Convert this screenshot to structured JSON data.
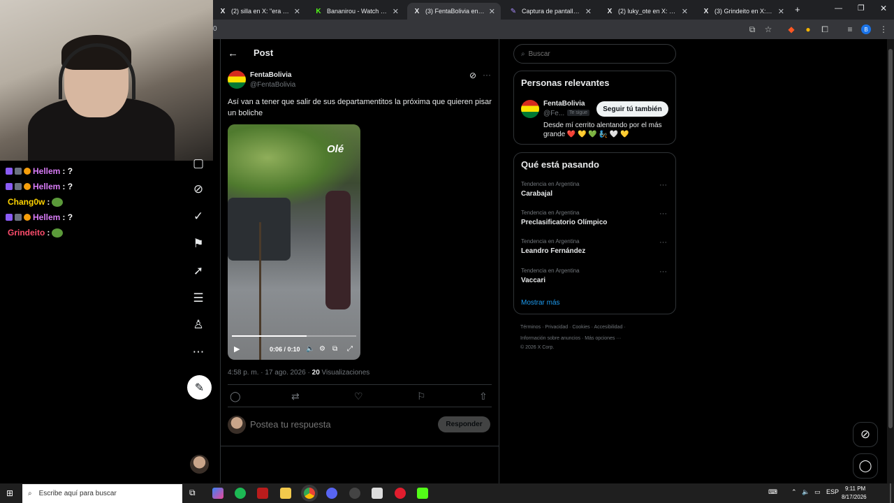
{
  "browser": {
    "tabs": [
      {
        "icon": "X",
        "title": "(2) silla en X: \"era el gol d",
        "active": false
      },
      {
        "icon": "K",
        "title": "Bananirou - Watch clips o",
        "active": false
      },
      {
        "icon": "X",
        "title": "(3) FentaBolivia en X: \"Así",
        "active": true
      },
      {
        "icon": "✎",
        "title": "Captura de pantalla por L",
        "active": false
      },
      {
        "icon": "X",
        "title": "(2) luky_ote en X: \"Hola E",
        "active": false
      },
      {
        "icon": "X",
        "title": "(3) Grindeito en X: \"@Fer",
        "active": false
      }
    ],
    "new_tab": "+",
    "address_fragment": "0"
  },
  "chat": [
    {
      "user": "Hellem",
      "msg": ": ?",
      "color": "#d97cf7",
      "badges": true
    },
    {
      "user": "Hellem",
      "msg": ": ?",
      "color": "#d97cf7",
      "badges": true
    },
    {
      "user": "Chang0w",
      "msg": ":",
      "color": "#ffd400",
      "emote": "pepe",
      "badges": false
    },
    {
      "user": "Hellem",
      "msg": ": ?",
      "color": "#d97cf7",
      "badges": true
    },
    {
      "user": "Grindeito",
      "msg": ":",
      "color": "#ff4d6d",
      "emote": "pepe",
      "badges": false
    }
  ],
  "post": {
    "header_title": "Post",
    "author_name": "FentaBolivia",
    "author_handle": "@FentaBolivia",
    "text": "Así van a tener que salir de sus departamentitos la próxima que quieren pisar un boliche",
    "video_watermark": "Olé",
    "video_time": "0:06 / 0:10",
    "video_progress": 0.6,
    "timestamp": "4:58 p. m. · 17 ago. 2026 ·",
    "views_count": "20",
    "views_label": "Visualizaciones",
    "reply_placeholder": "Postea tu respuesta",
    "reply_button": "Responder"
  },
  "sidebar": {
    "search_placeholder": "Buscar",
    "relevant_title": "Personas relevantes",
    "relevant_name": "FentaBolivia",
    "relevant_handle": "@Fe...",
    "relevant_follows_you": "Te sigue",
    "follow_back_button": "Seguir tú también",
    "relevant_bio": "Desde mí cerrito alentando por el más grande ❤️ 💛 💚 🧞 🤍 💛",
    "trending_title": "Qué está pasando",
    "trends": [
      {
        "category": "Tendencia en Argentina",
        "name": "Carabajal"
      },
      {
        "category": "Tendencia en Argentina",
        "name": "Preclasificatorio Olímpico"
      },
      {
        "category": "Tendencia en Argentina",
        "name": "Leandro Fernández"
      },
      {
        "category": "Tendencia en Argentina",
        "name": "Vaccari"
      }
    ],
    "show_more": "Mostrar más",
    "footer_line1": [
      "Términos",
      "Privacidad",
      "Cookies",
      "Accesibilidad"
    ],
    "footer_line2": [
      "Información sobre anuncios",
      "Más opciones ···"
    ],
    "copyright": "© 2026 X Corp."
  },
  "taskbar": {
    "search_placeholder": "Escribe aquí para buscar",
    "language": "ESP",
    "time": "9:11 PM",
    "date": "8/17/2026"
  }
}
